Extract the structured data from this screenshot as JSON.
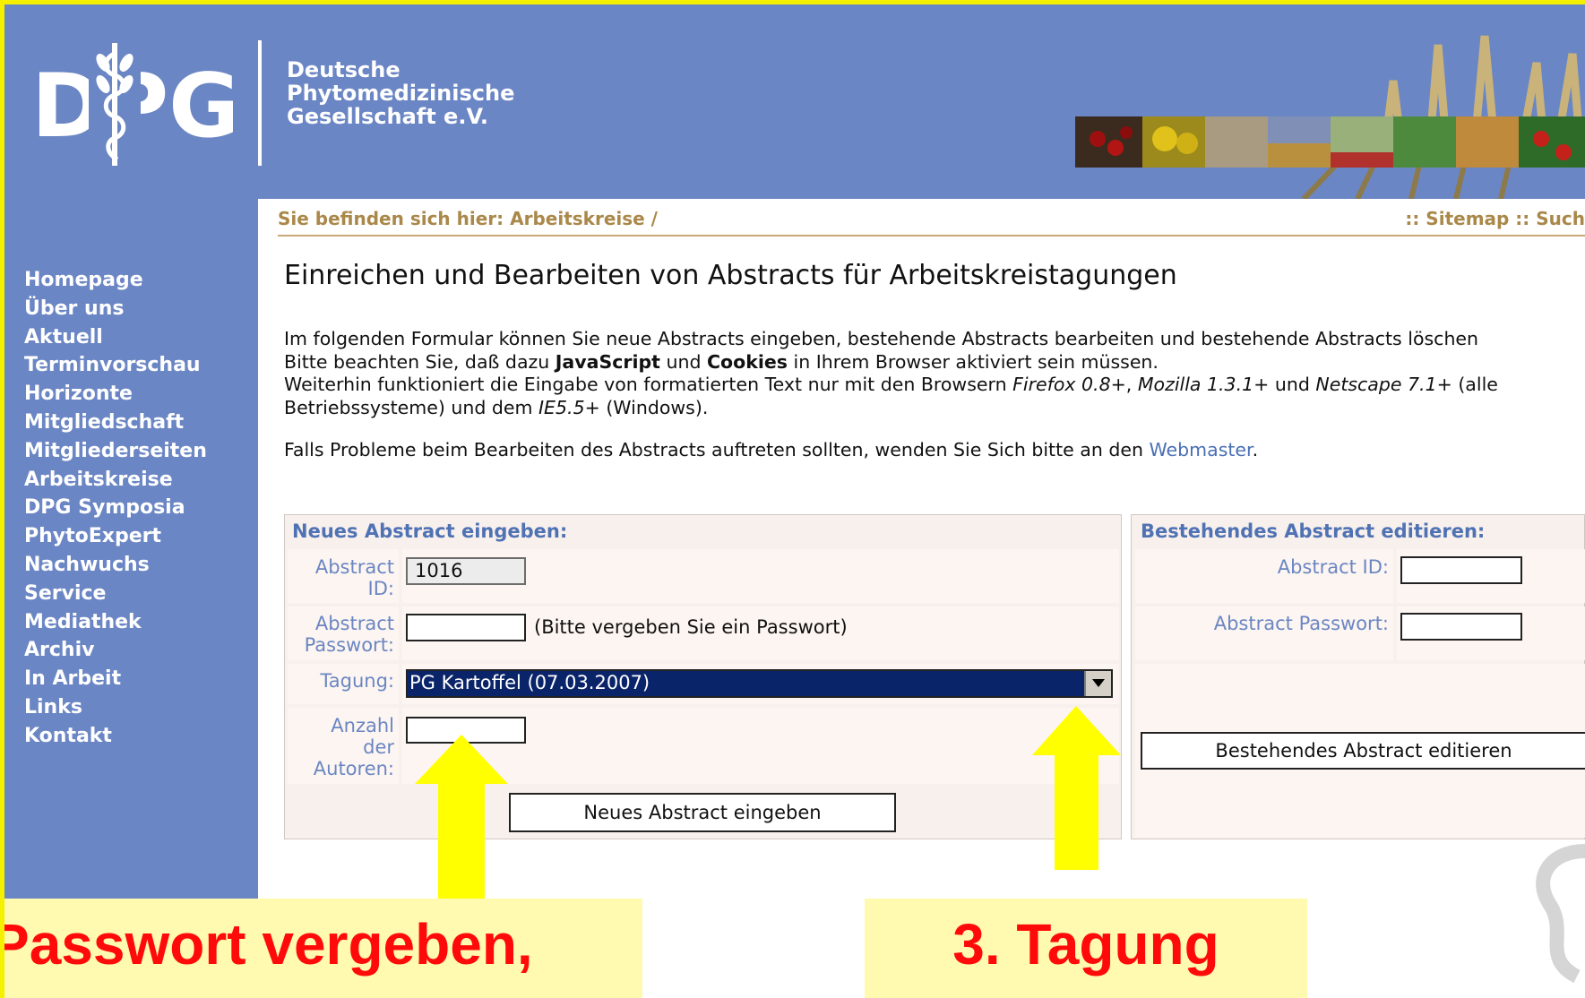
{
  "header": {
    "logo_text": "DPG",
    "org_name": [
      "Deutsche",
      "Phytomedizinische",
      "Gesellschaft e.V."
    ]
  },
  "breadcrumb": {
    "label": "Sie befinden sich hier: Arbeitskreise /",
    "links": ":: Sitemap :: Such"
  },
  "sidebar": {
    "items": [
      "Homepage",
      "Über uns",
      "Aktuell",
      "Terminvorschau",
      "Horizonte",
      "Mitgliedschaft",
      "Mitgliederseiten",
      "Arbeitskreise",
      "DPG Symposia",
      "PhytoExpert",
      "Nachwuchs",
      "Service",
      "Mediathek",
      "Archiv",
      "In Arbeit",
      "Links",
      "Kontakt"
    ]
  },
  "main": {
    "title": "Einreichen und Bearbeiten von Abstracts für Arbeitskreistagungen",
    "intro_line1": "Im folgenden Formular können Sie neue Abstracts eingeben, bestehende Abstracts bearbeiten und bestehende Abstracts löschen",
    "intro_line2_a": "Bitte beachten Sie, daß dazu ",
    "intro_line2_b": "JavaScript",
    "intro_line2_c": " und ",
    "intro_line2_d": "Cookies",
    "intro_line2_e": " in Ihrem Browser aktiviert sein müssen.",
    "intro_line3_a": "Weiterhin funktioniert die Eingabe von formatierten Text nur mit den Browsern ",
    "intro_line3_b": "Firefox 0.8+",
    "intro_line3_c": ", ",
    "intro_line3_d": "Mozilla 1.3.1+",
    "intro_line3_e": " und ",
    "intro_line3_f": "Netscape 7.1+",
    "intro_line3_g": " (alle",
    "intro_line4_a": "Betriebssysteme) und dem ",
    "intro_line4_b": "IE5.5+",
    "intro_line4_c": " (Windows).",
    "help_text": "Falls Probleme beim Bearbeiten des Abstracts auftreten sollten, wenden Sie Sich bitte an den ",
    "help_link": "Webmaster",
    "help_end": "."
  },
  "new_abstract": {
    "heading": "Neues Abstract eingeben:",
    "id_label": "Abstract ID:",
    "id_value": "1016",
    "password_label": "Abstract Passwort:",
    "password_value": "",
    "password_note": "(Bitte vergeben Sie ein Passwort)",
    "tagung_label": "Tagung:",
    "tagung_selected": "PG Kartoffel (07.03.2007)",
    "authors_label": "Anzahl der Autoren:",
    "authors_value": "",
    "submit_label": "Neues Abstract eingeben"
  },
  "edit_abstract": {
    "heading": "Bestehendes Abstract editieren:",
    "id_label": "Abstract ID:",
    "id_value": "",
    "password_label": "Abstract Passwort:",
    "password_value": "",
    "submit_label": "Bestehendes Abstract editieren"
  },
  "callouts": {
    "left": "Passwort vergeben,",
    "right": "3. Tagung"
  },
  "colors": {
    "header_blue": "#6b86c4",
    "callout_bg": "#fffaaf",
    "callout_text": "#ff0a0a",
    "arrow_yellow": "#ffff00"
  }
}
